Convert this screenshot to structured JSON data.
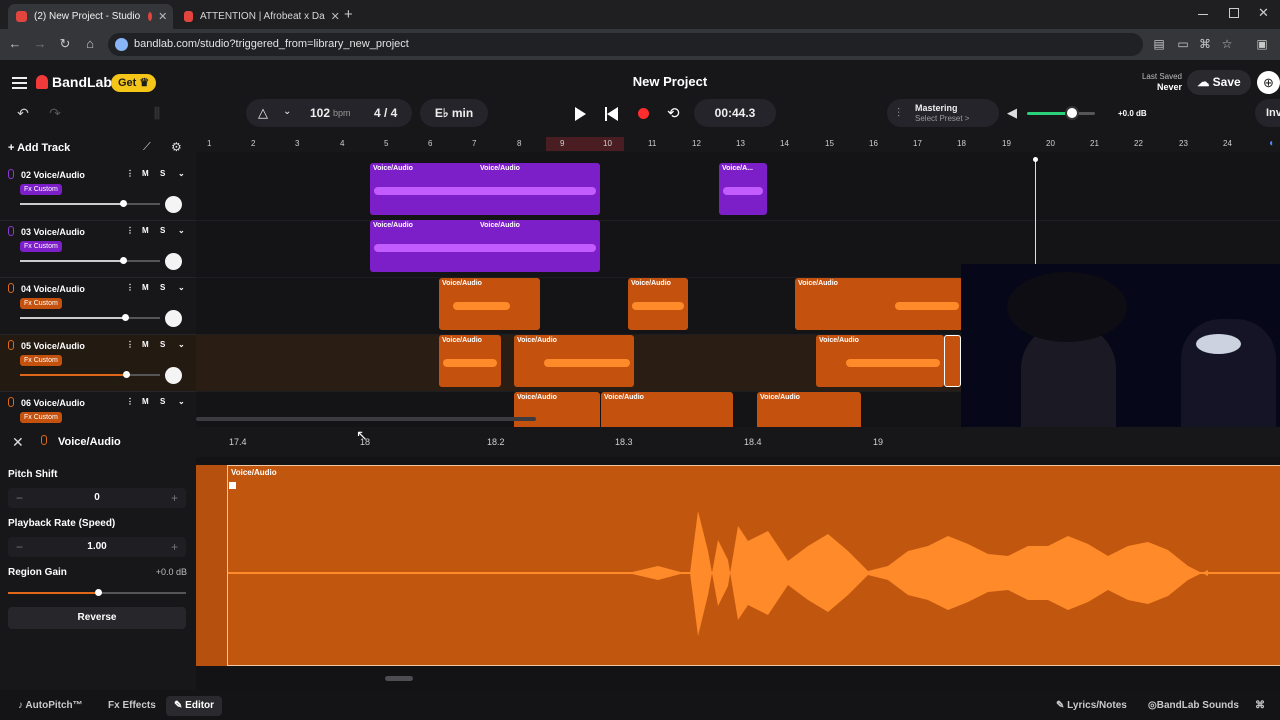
{
  "browser": {
    "tabs": [
      {
        "title": "(2) New Project - Studio",
        "active": true
      },
      {
        "title": "ATTENTION | Afrobeat x Da",
        "active": false
      }
    ],
    "new_tab": "+",
    "url": "bandlab.com/studio?triggered_from=library_new_project"
  },
  "app": {
    "brand": "BandLab",
    "get_label": "Get",
    "project_title": "New Project",
    "last_saved_label": "Last Saved",
    "last_saved_value": "Never",
    "save_label": "Save"
  },
  "transport": {
    "bpm_value": "102",
    "bpm_unit": "bpm",
    "time_signature": "4 / 4",
    "key": "E♭ min",
    "time": "00:44.3",
    "mastering_label": "Mastering",
    "mastering_sub": "Select Preset >",
    "master_gain": "+0.0 dB",
    "inv_label": "Inv"
  },
  "tracks_panel": {
    "add_track": "Add Track",
    "tracks": [
      {
        "name": "02 Voice/Audio",
        "fx": "Fx Custom",
        "color": "#7d1fc8"
      },
      {
        "name": "03 Voice/Audio",
        "fx": "Fx Custom",
        "color": "#7d1fc8"
      },
      {
        "name": "04 Voice/Audio",
        "fx": "Fx Custom",
        "color": "#c4520e"
      },
      {
        "name": "05 Voice/Audio",
        "fx": "Fx Custom",
        "color": "#c4520e"
      },
      {
        "name": "06 Voice/Audio",
        "fx": "Fx Custom",
        "color": "#c4520e"
      }
    ],
    "mute": "M",
    "solo": "S"
  },
  "ruler": {
    "bars": [
      "1",
      "2",
      "3",
      "4",
      "5",
      "6",
      "7",
      "8",
      "9",
      "10",
      "11",
      "12",
      "13",
      "14",
      "15",
      "16",
      "17",
      "18",
      "19",
      "20",
      "21",
      "22",
      "23",
      "24"
    ]
  },
  "clips": {
    "label": "Voice/Audio",
    "short_label": "Voice/A..."
  },
  "editor": {
    "title": "Voice/Audio",
    "sub_ruler": [
      "17.4",
      "18",
      "18.2",
      "18.3",
      "18.4",
      "19"
    ],
    "pitch_shift_label": "Pitch Shift",
    "pitch_shift_value": "0",
    "rate_label": "Playback Rate (Speed)",
    "rate_value": "1.00",
    "gain_label": "Region Gain",
    "gain_value": "+0.0 dB",
    "reverse_label": "Reverse",
    "region_label": "Voice/Audio"
  },
  "bottom": {
    "autopitch": "AutoPitch™",
    "effects": "Effects",
    "effects_prefix": "Fx",
    "editor": "Editor",
    "lyrics": "Lyrics/Notes",
    "sounds": "BandLab Sounds"
  },
  "colors": {
    "purple_clip": "#7d1fc8",
    "orange_clip": "#c4520e",
    "record": "#ff2d2d",
    "get_badge": "#f5c518"
  }
}
